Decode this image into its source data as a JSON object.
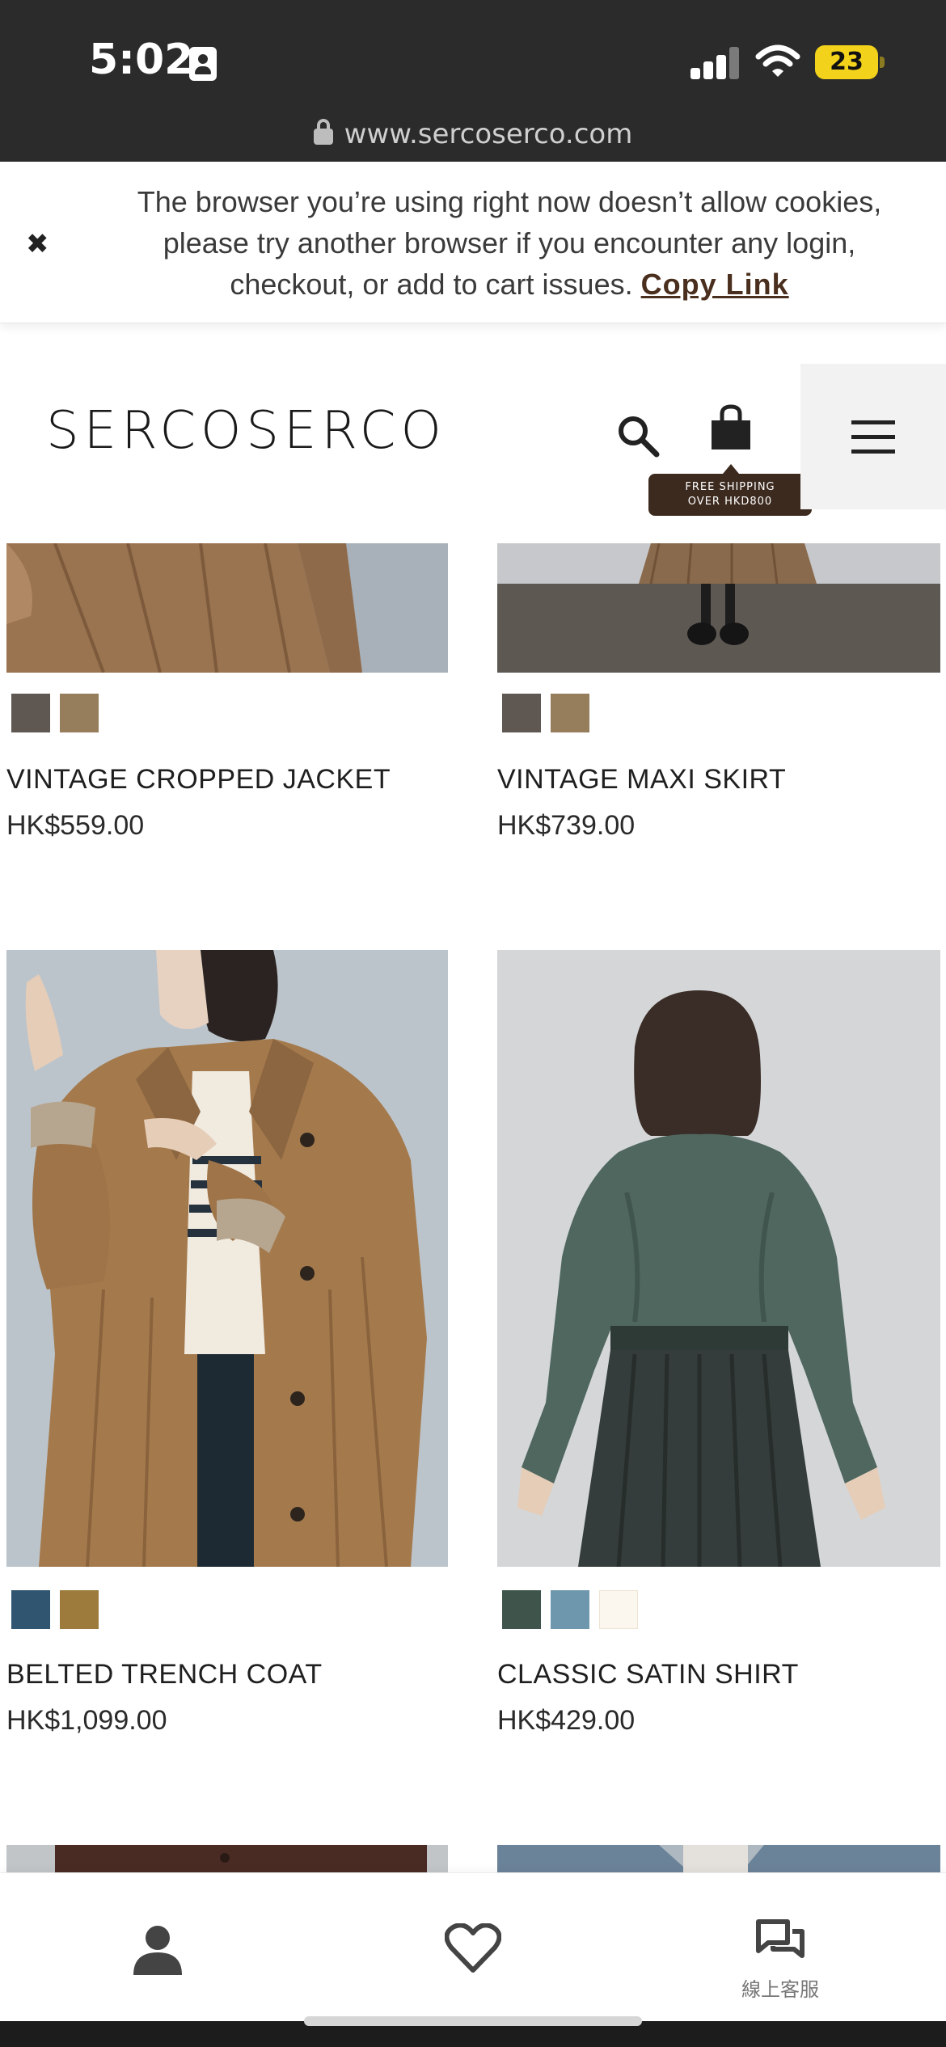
{
  "status_bar": {
    "time": "5:02",
    "battery": "23",
    "url": "www.sercoserco.com"
  },
  "cookie_banner": {
    "message": "The browser you’re using right now doesn’t allow cookies, please try another browser if you encounter any login, checkout, or add to cart issues.",
    "link_label": "Copy Link"
  },
  "header": {
    "logo": "SERCOSERCO",
    "shipping_line1": "FREE SHIPPING",
    "shipping_line2": "OVER HKD800"
  },
  "products": [
    {
      "name": "VINTAGE CROPPED JACKET",
      "price": "HK$559.00",
      "swatches": [
        "#5e5752",
        "#967d5c"
      ]
    },
    {
      "name": "VINTAGE MAXI SKIRT",
      "price": "HK$739.00",
      "swatches": [
        "#5e5752",
        "#967d5c"
      ]
    },
    {
      "name": "BELTED TRENCH COAT",
      "price": "HK$1,099.00",
      "swatches": [
        "#2f5570",
        "#9c7b3c"
      ]
    },
    {
      "name": "CLASSIC SATIN SHIRT",
      "price": "HK$429.00",
      "swatches": [
        "#3f544b",
        "#6e97ae",
        "#fbf7ef"
      ]
    }
  ],
  "bottom_nav": {
    "chat_label": "線上客服"
  },
  "colors": {
    "status_bg": "#2b2b2b",
    "brand_brown": "#3c2a1f",
    "battery_yellow": "#f2d21a"
  }
}
